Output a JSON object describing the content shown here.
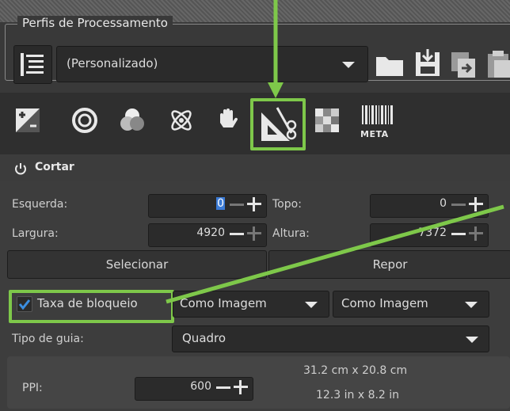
{
  "profiles": {
    "title": "Perfis de Processamento",
    "selected": "(Personalizado)"
  },
  "toolbar": {
    "meta_label": "META"
  },
  "section": {
    "title": "Cortar"
  },
  "crop": {
    "left_label": "Esquerda:",
    "left_value": "0",
    "top_label": "Topo:",
    "top_value": "0",
    "width_label": "Largura:",
    "width_value": "4920",
    "height_label": "Altura:",
    "height_value": "7372",
    "select_button": "Selecionar",
    "reset_button": "Repor",
    "lock_ratio_label": "Taxa de bloqueio",
    "ratio_option_1": "Como Imagem",
    "ratio_option_2": "Como Imagem",
    "guide_label": "Tipo de guia:",
    "guide_value": "Quadro",
    "ppi_label": "PPI:",
    "ppi_value": "600",
    "size_cm": "31.2 cm x 20.8 cm",
    "size_in": "12.3 in x 8.2 in"
  },
  "colors": {
    "highlight": "#7ec84a",
    "accent": "#3b7bd6"
  }
}
